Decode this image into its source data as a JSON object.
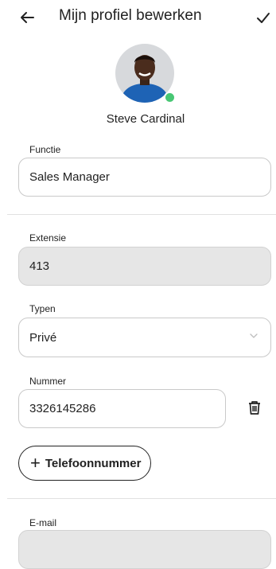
{
  "header": {
    "title": "Mijn profiel bewerken"
  },
  "profile": {
    "name": "Steve Cardinal"
  },
  "fields": {
    "functie": {
      "label": "Functie",
      "value": "Sales Manager"
    },
    "extensie": {
      "label": "Extensie",
      "value": "413"
    },
    "typen": {
      "label": "Typen",
      "value": "Privé"
    },
    "nummer": {
      "label": "Nummer",
      "value": "3326145286"
    },
    "email": {
      "label": "E-mail",
      "value": ""
    }
  },
  "actions": {
    "add_phone": "Telefoonnummer",
    "add_phone_icon": "+"
  },
  "colors": {
    "status_online": "#48c774",
    "avatar_shirt": "#1e63b5"
  }
}
